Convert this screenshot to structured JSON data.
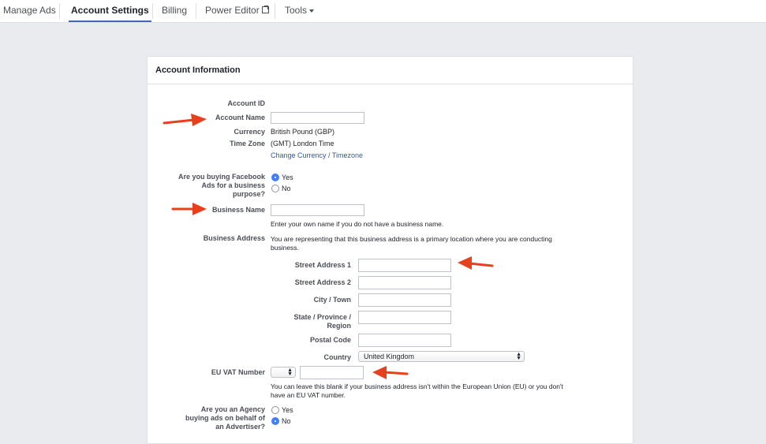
{
  "nav": {
    "tabs": [
      {
        "label": "Manage Ads"
      },
      {
        "label": "Account Settings"
      },
      {
        "label": "Billing"
      },
      {
        "label": "Power Editor"
      },
      {
        "label": "Tools"
      }
    ]
  },
  "card": {
    "title": "Account Information",
    "account_id_label": "Account ID",
    "account_name_label": "Account Name",
    "account_name_value": "",
    "currency_label": "Currency",
    "currency_value": "British Pound (GBP)",
    "timezone_label": "Time Zone",
    "timezone_value": "(GMT) London Time",
    "change_link": "Change Currency / Timezone",
    "business_purpose": {
      "label_lines": [
        "Are you buying Facebook",
        "Ads for a business",
        "purpose?"
      ],
      "options": [
        "Yes",
        "No"
      ],
      "selected": "Yes"
    },
    "business_name_label": "Business Name",
    "business_name_value": "",
    "business_name_note": "Enter your own name if you do not have a business name.",
    "business_address_label": "Business Address",
    "business_address_note_lines": [
      "You are representing that this business address is a primary location where you are conducting",
      "business."
    ],
    "address_fields": {
      "street1": "Street Address 1",
      "street2": "Street Address 2",
      "city": "City / Town",
      "state_lines": [
        "State / Province /",
        "Region"
      ],
      "postal": "Postal Code",
      "country": "Country"
    },
    "country_value": "United Kingdom",
    "vat_label": "EU VAT Number",
    "vat_note_lines": [
      "You can leave this blank if your business address isn't within the European Union (EU) or you don't",
      "have an EU VAT number."
    ],
    "agency": {
      "label_lines": [
        "Are you an Agency",
        "buying ads on behalf of",
        "an Advertiser?"
      ],
      "options": [
        "Yes",
        "No"
      ],
      "selected": "No"
    }
  },
  "colors": {
    "accent": "#4267b2",
    "link": "#365899",
    "radio_on": "#4080ff",
    "arrow": "#e8401c",
    "page_bg": "#e9ebee"
  }
}
